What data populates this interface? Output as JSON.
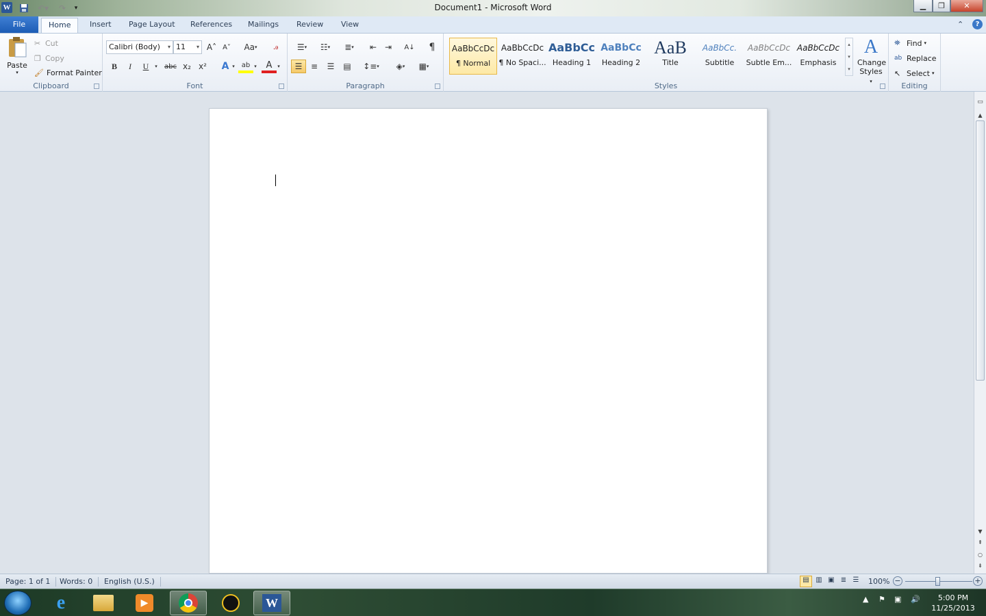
{
  "window": {
    "title": "Document1  -  Microsoft Word",
    "app_icon_letter": "W"
  },
  "tabs": [
    "File",
    "Home",
    "Insert",
    "Page Layout",
    "References",
    "Mailings",
    "Review",
    "View"
  ],
  "active_tab": "Home",
  "clipboard": {
    "paste": "Paste",
    "cut": "Cut",
    "copy": "Copy",
    "format_painter": "Format Painter",
    "label": "Clipboard"
  },
  "font": {
    "family": "Calibri (Body)",
    "size": "11",
    "change_case": "Aa",
    "label": "Font",
    "bold": "B",
    "italic": "I",
    "underline": "U",
    "strike": "abc",
    "subscript": "x₂",
    "superscript": "x²",
    "grow": "A˄",
    "shrink": "A˅",
    "font_color": "A",
    "highlight": "ab",
    "text_effects": "A"
  },
  "paragraph": {
    "label": "Paragraph",
    "show_marks": "¶",
    "sort": "A↓"
  },
  "styles": {
    "label": "Styles",
    "items": [
      {
        "preview": "AaBbCcDc",
        "name": "¶ Normal"
      },
      {
        "preview": "AaBbCcDc",
        "name": "¶ No Spaci..."
      },
      {
        "preview": "AaBbCc",
        "name": "Heading 1"
      },
      {
        "preview": "AaBbCc",
        "name": "Heading 2"
      },
      {
        "preview": "AaB",
        "name": "Title"
      },
      {
        "preview": "AaBbCc.",
        "name": "Subtitle"
      },
      {
        "preview": "AaBbCcDc",
        "name": "Subtle Em..."
      },
      {
        "preview": "AaBbCcDc",
        "name": "Emphasis"
      }
    ],
    "change_styles_line1": "Change",
    "change_styles_line2": "Styles"
  },
  "editing": {
    "label": "Editing",
    "find": "Find",
    "replace": "Replace",
    "select": "Select"
  },
  "status": {
    "page": "Page: 1 of 1",
    "words": "Words: 0",
    "language": "English (U.S.)",
    "zoom": "100%"
  },
  "taskbar": {
    "time": "5:00 PM",
    "date": "11/25/2013"
  },
  "colors": {
    "accent": "#2b5797",
    "file_tab": "#1c5cb5",
    "highlight_yellow": "#ffff00",
    "font_color_red": "#e02020"
  }
}
